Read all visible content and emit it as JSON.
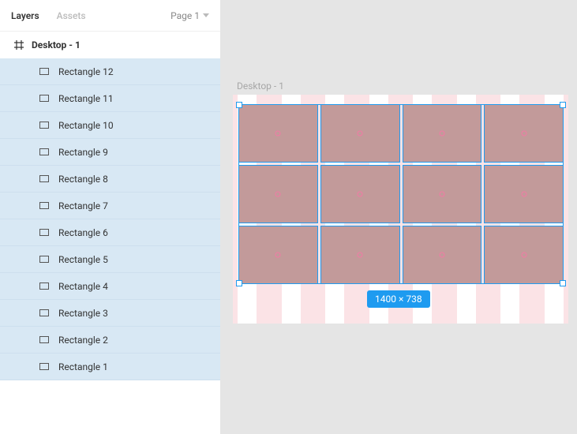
{
  "sidebar": {
    "tabs": {
      "layers": "Layers",
      "assets": "Assets"
    },
    "page_selector": "Page 1",
    "frame_name": "Desktop - 1",
    "layers": [
      {
        "label": "Rectangle 12"
      },
      {
        "label": "Rectangle 11"
      },
      {
        "label": "Rectangle 10"
      },
      {
        "label": "Rectangle 9"
      },
      {
        "label": "Rectangle 8"
      },
      {
        "label": "Rectangle 7"
      },
      {
        "label": "Rectangle 6"
      },
      {
        "label": "Rectangle 5"
      },
      {
        "label": "Rectangle 4"
      },
      {
        "label": "Rectangle 3"
      },
      {
        "label": "Rectangle 2"
      },
      {
        "label": "Rectangle 1"
      }
    ]
  },
  "canvas": {
    "frame_label": "Desktop - 1",
    "selection_size": "1400 × 738",
    "selection_color": "#1e9bf0",
    "artboard_bg": "#fbe3e6",
    "rect_fill": "#c29a9a",
    "grid_rows": 3,
    "grid_cols": 4
  }
}
